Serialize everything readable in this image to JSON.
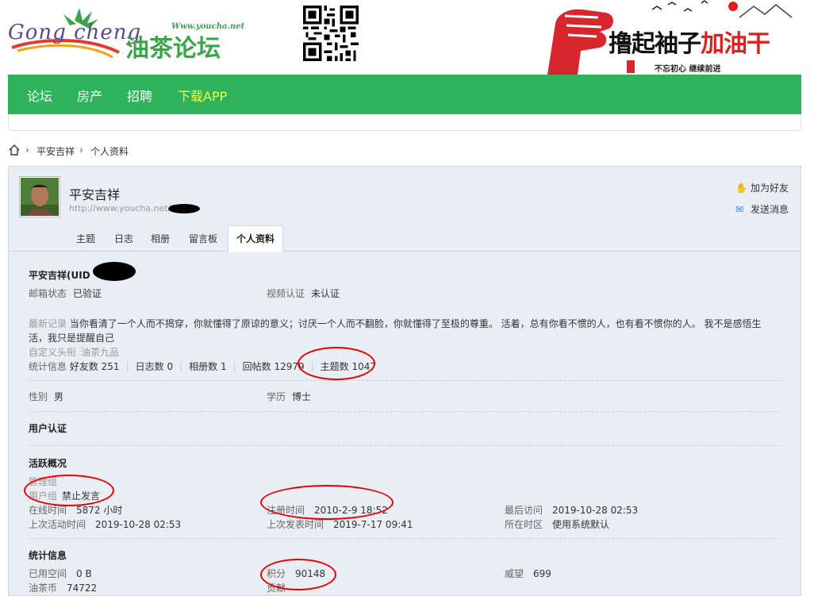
{
  "header": {
    "logo_en": "Gong cheng",
    "logo_cn": "油茶论坛",
    "logo_url": "Www.youcha.net",
    "slogan_left": "撸起袖子",
    "slogan_right": "加油干",
    "slogan_sub": "不忘初心   继续前进",
    "seal": "书法"
  },
  "nav": {
    "items": [
      "论坛",
      "房产",
      "招聘",
      "下载APP"
    ]
  },
  "breadcrumb": {
    "items": [
      "平安吉祥",
      "个人资料"
    ]
  },
  "profile": {
    "name": "平安吉祥",
    "url": "http://www.youcha.net/?",
    "actions": {
      "add_friend": "加为好友",
      "send_message": "发送消息"
    },
    "tabs": [
      "主题",
      "日志",
      "相册",
      "留言板",
      "个人资料"
    ],
    "uid_label": "平安吉祥(UID",
    "email_status": {
      "label": "邮箱状态",
      "value": "已验证"
    },
    "video_auth": {
      "label": "视频认证",
      "value": "未认证"
    },
    "latest_record": {
      "label": "最新记录",
      "text": "当你看清了一个人而不揭穿，你就懂得了原谅的意义；讨厌一个人而不翻脸，你就懂得了至极的尊重。 活着，总有你看不惯的人，也有看不惯你的人。 我不是感悟生",
      "text2": "活，我只是提醒自己"
    },
    "custom_title": {
      "label": "自定义头衔",
      "value": "油茶九品"
    },
    "stats": {
      "label": "统计信息",
      "items": [
        "好友数 251",
        "日志数 0",
        "相册数 1",
        "回帖数 12979",
        "主题数 1047"
      ]
    },
    "gender": {
      "label": "性别",
      "value": "男"
    },
    "education": {
      "label": "学历",
      "value": "博士"
    },
    "user_auth_title": "用户认证",
    "activity_title": "活跃概况",
    "admin_group_label": "管理组",
    "user_group": {
      "label": "用户组",
      "value": "禁止发言"
    },
    "online_time": {
      "label": "在线时间",
      "value": "5872 小时"
    },
    "reg_time": {
      "label": "注册时间",
      "value": "2010-2-9 18:52"
    },
    "last_visit": {
      "label": "最后访问",
      "value": "2019-10-28 02:53"
    },
    "last_activity": {
      "label": "上次活动时间",
      "value": "2019-10-28 02:53"
    },
    "last_post": {
      "label": "上次发表时间",
      "value": "2019-7-17 09:41"
    },
    "region": {
      "label": "所在时区",
      "value": "使用系统默认"
    },
    "stats_title": "统计信息",
    "used_space": {
      "label": "已用空间",
      "value": "0 B"
    },
    "points": {
      "label": "积分",
      "value": "90148"
    },
    "prestige": {
      "label": "威望",
      "value": "699"
    },
    "oil_tea": {
      "label": "油茶币",
      "value": "74722"
    },
    "cut_label": "贡献"
  },
  "colors": {
    "nav_green": "#2fb25c",
    "nav_highlight": "#f6ff3c",
    "annotation_red": "#ee0000"
  }
}
